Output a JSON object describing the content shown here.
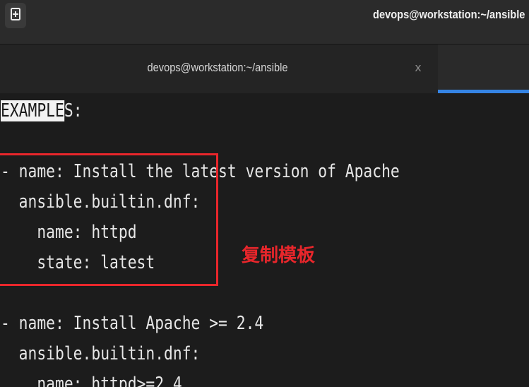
{
  "header": {
    "new_tab_icon": "new-tab-icon",
    "title": "devops@workstation:~/ansible"
  },
  "tabs": [
    {
      "label": "devops@workstation:~/ansible",
      "close_glyph": "x"
    }
  ],
  "colors": {
    "accent": "#3584e4",
    "annotation": "#e8262b",
    "terminal_bg": "#1c1c1c"
  },
  "terminal": {
    "examples_highlight": "EXAMPLE",
    "examples_rest": "S:",
    "lines": [
      "- name: Install the latest version of Apache",
      "  ansible.builtin.dnf:",
      "    name: httpd",
      "    state: latest",
      "",
      "- name: Install Apache >= 2.4",
      "  ansible.builtin.dnf:",
      "    name: httpd>=2.4"
    ]
  },
  "annotation": {
    "text": "复制模板"
  }
}
